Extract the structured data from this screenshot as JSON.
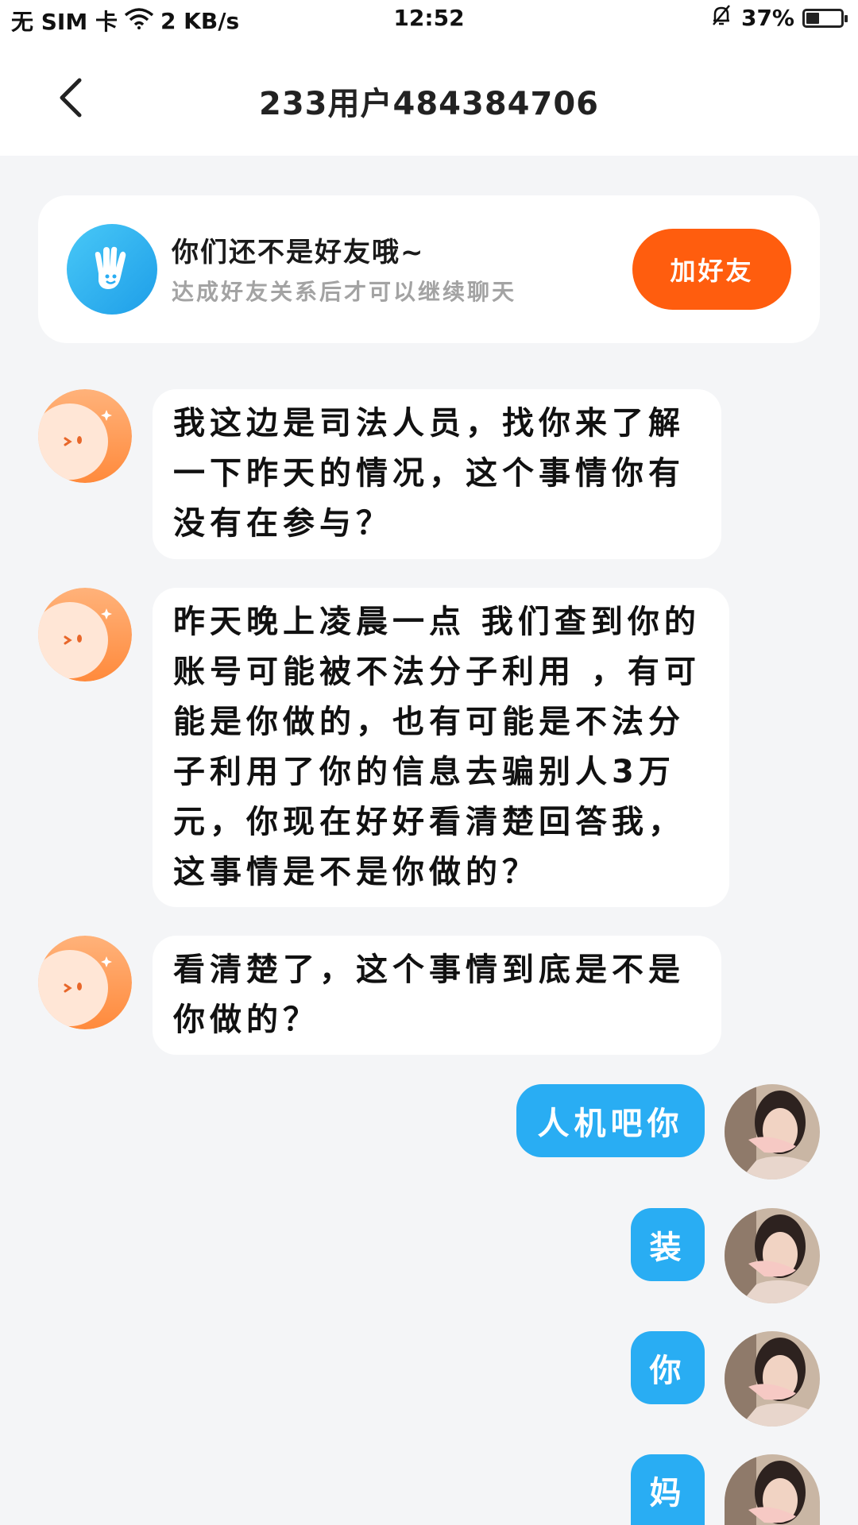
{
  "status_bar": {
    "carrier": "无 SIM 卡",
    "speed": "2 KB/s",
    "time": "12:52",
    "battery": "37%",
    "battery_level": 0.37
  },
  "header": {
    "title": "233用户484384706"
  },
  "friend_card": {
    "title": "你们还不是好友哦~",
    "subtitle": "达成好友关系后才可以继续聊天",
    "button": "加好友"
  },
  "colors": {
    "accent_blue": "#29adf3",
    "add_button_orange": "#ff5d0e",
    "background": "#f4f5f7"
  },
  "messages": [
    {
      "side": "left",
      "text": "我这边是司法人员，找你来了解一下昨天的情况，这个事情你有没有在参与？"
    },
    {
      "side": "left",
      "text": "昨天晚上凌晨一点 我们查到你的账号可能被不法分子利用 ，有可能是你做的，也有可能是不法分子利用了你的信息去骗别人3万元，你现在好好看清楚回答我，这事情是不是你做的？"
    },
    {
      "side": "left",
      "text": "看清楚了，这个事情到底是不是你做的？"
    },
    {
      "side": "right",
      "text": "人机吧你"
    },
    {
      "side": "right",
      "text": "装"
    },
    {
      "side": "right",
      "text": "你"
    },
    {
      "side": "right",
      "text": "妈"
    }
  ]
}
